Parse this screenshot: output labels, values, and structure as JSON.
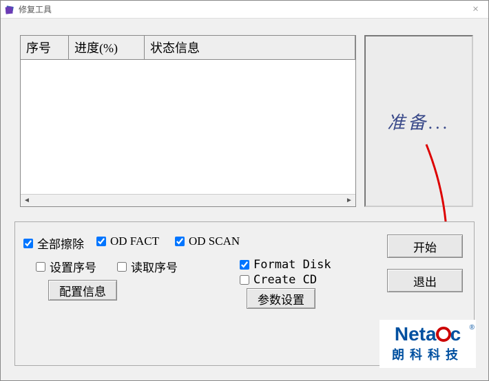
{
  "window": {
    "title": "修复工具",
    "close_symbol": "×"
  },
  "table": {
    "columns": [
      "序号",
      "进度(%)",
      "状态信息"
    ],
    "rows": []
  },
  "status": {
    "text": "准备..."
  },
  "options": {
    "erase_all": {
      "label": "全部擦除",
      "checked": true
    },
    "od_fact": {
      "label": "OD FACT",
      "checked": true
    },
    "od_scan": {
      "label": "OD SCAN",
      "checked": true
    },
    "set_serial": {
      "label": "设置序号",
      "checked": false
    },
    "read_serial": {
      "label": "读取序号",
      "checked": false
    },
    "format_disk": {
      "label": "Format Disk",
      "checked": true
    },
    "create_cd": {
      "label": "Create CD",
      "checked": false
    }
  },
  "buttons": {
    "config_info": "配置信息",
    "param_settings": "参数设置",
    "start": "开始",
    "exit": "退出"
  },
  "logo": {
    "brand_prefix": "Neta",
    "brand_suffix": "c",
    "brand_cn": "朗科科技",
    "registered": "®"
  },
  "scrollbar": {
    "left_arrow": "◄",
    "right_arrow": "►"
  }
}
